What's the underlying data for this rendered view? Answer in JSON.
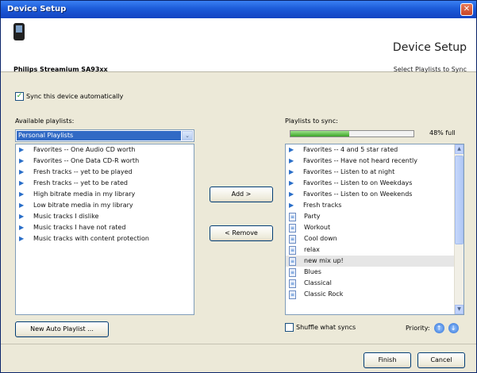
{
  "window": {
    "title": "Device Setup",
    "close_glyph": "✕"
  },
  "header": {
    "device_name": "Philips Streamium SA93xx",
    "page_title": "Device Setup",
    "page_subtitle": "Select Playlists to Sync"
  },
  "sync_auto": {
    "label": "Sync this device automatically",
    "checked": true,
    "check_glyph": "✓"
  },
  "available": {
    "label": "Available playlists:",
    "selected_option": "Personal Playlists",
    "dropdown_glyph": "⌄",
    "items": [
      "Favorites -- One Audio CD worth",
      "Favorites -- One Data CD-R worth",
      "Fresh tracks -- yet to be played",
      "Fresh tracks -- yet to be rated",
      "High bitrate media in my library",
      "Low bitrate media in my library",
      "Music tracks I dislike",
      "Music tracks I have not rated",
      "Music tracks with content protection"
    ]
  },
  "buttons": {
    "add": "Add  >",
    "remove": "<  Remove",
    "new_auto_playlist": "New Auto Playlist ...",
    "finish": "Finish",
    "cancel": "Cancel"
  },
  "sync": {
    "label": "Playlists to sync:",
    "capacity_fraction": 0.48,
    "capacity_text": "48% full",
    "auto_items": [
      "Favorites -- 4 and 5 star rated",
      "Favorites -- Have not heard recently",
      "Favorites -- Listen to at night",
      "Favorites -- Listen to on Weekdays",
      "Favorites -- Listen to on Weekends",
      "Fresh tracks"
    ],
    "static_items": [
      "Party",
      "Workout",
      "Cool down",
      "relax",
      "new mix up!",
      "Blues",
      "Classical",
      "Classic Rock"
    ],
    "selected_item": "new mix up!"
  },
  "shuffle": {
    "label": "Shuffle what syncs",
    "checked": false
  },
  "priority": {
    "label": "Priority:",
    "up_glyph": "↑",
    "down_glyph": "↓"
  },
  "icons": {
    "auto_playlist": "arrow-icon",
    "static_playlist": "playlist-doc-icon",
    "arrow_glyph": "▶",
    "doc_glyph": "≡",
    "scroll_up_glyph": "▲",
    "scroll_down_glyph": "▼"
  },
  "colors": {
    "titlebar": "#1c5bd8",
    "selection": "#316ac5",
    "capacity_fill": "#3aa427"
  }
}
